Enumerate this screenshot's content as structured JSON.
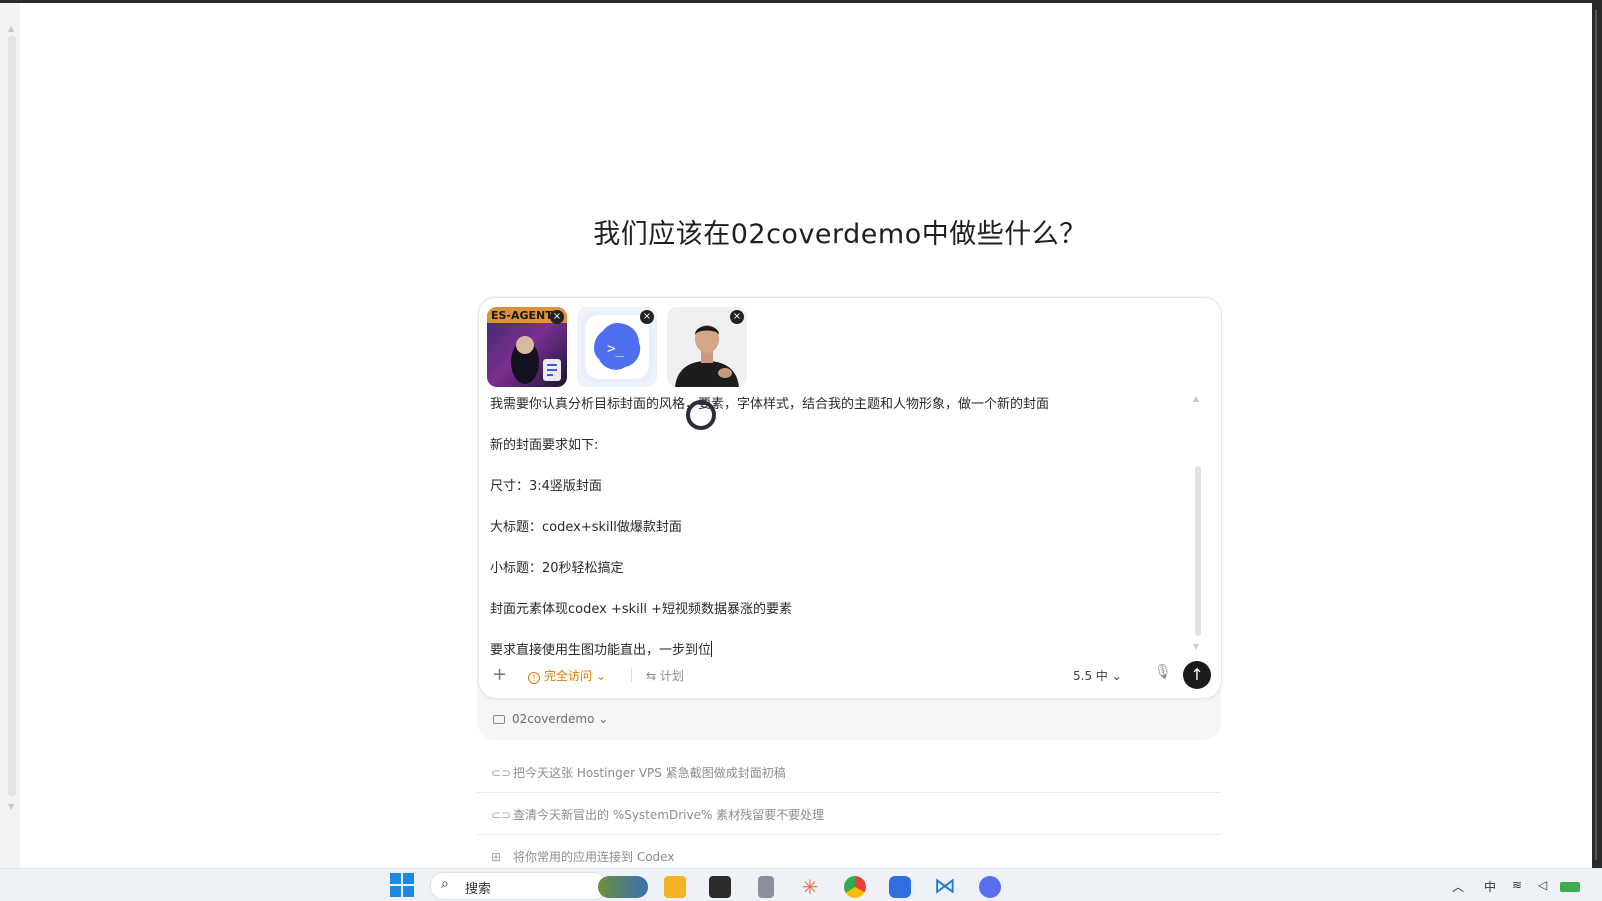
{
  "heading": "我们应该在02coverdemo中做些什么？",
  "attachments": [
    {
      "name": "thumbnail-1",
      "overlay_text": "ES-AGENT"
    },
    {
      "name": "thumbnail-2",
      "overlay_text": ">_"
    },
    {
      "name": "thumbnail-3",
      "overlay_text": ""
    }
  ],
  "prompt": {
    "lines": [
      "我需要你认真分析目标封面的风格，要素，字体样式，结合我的主题和人物形象，做一个新的封面",
      "新的封面要求如下:",
      "尺寸：3:4竖版封面",
      "大标题：codex+skill做爆款封面",
      "小标题：20秒轻松搞定",
      "封面元素体现codex +skill +短视频数据暴涨的要素",
      "要求直接使用生图功能直出，一步到位"
    ]
  },
  "toolbar": {
    "add_label": "+",
    "access_label": "完全访问",
    "access_caret": "⌄",
    "plan_label": "计划",
    "model_label": "5.5 中",
    "model_caret": "⌄",
    "send_label": "↑"
  },
  "project": {
    "folder_label": "02coverdemo",
    "caret": "⌄"
  },
  "suggestions": [
    "把今天这张 Hostinger VPS 紧急截图做成封面初稿",
    "查清今天新冒出的 %SystemDrive% 素材残留要不要处理",
    "将你常用的应用连接到 Codex"
  ],
  "taskbar": {
    "search_placeholder": "搜索",
    "tray_input": "中"
  },
  "colors": {
    "accent_warning": "#e07a00",
    "send_button": "#1b1b1b",
    "taskbar_bg": "#eef1f6"
  }
}
